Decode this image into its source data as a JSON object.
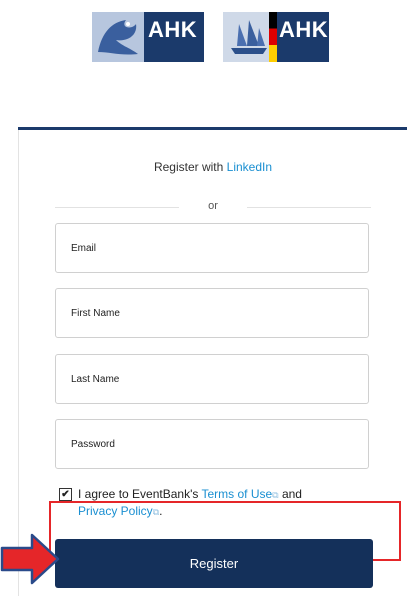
{
  "logos": {
    "left_text": "AHK",
    "right_text": "AHK"
  },
  "signup": {
    "linkedin_prefix": "Register with ",
    "linkedin_link": "LinkedIn",
    "separator": "or"
  },
  "fields": {
    "email_placeholder": "Email",
    "first_name_placeholder": "First Name",
    "last_name_placeholder": "Last Name",
    "password_placeholder": "Password"
  },
  "agreement": {
    "checked": true,
    "checkmark": "✔",
    "prefix": "I agree to EventBank's ",
    "terms_link": "Terms of Use",
    "middle": " and",
    "privacy_link": "Privacy Policy",
    "suffix": ".",
    "external_icon": "external-link-icon"
  },
  "register_button": {
    "label": "Register"
  },
  "colors": {
    "navy": "#14305a",
    "link": "#1a8fd1",
    "highlight": "#e52629",
    "arrow": "#e52629"
  }
}
